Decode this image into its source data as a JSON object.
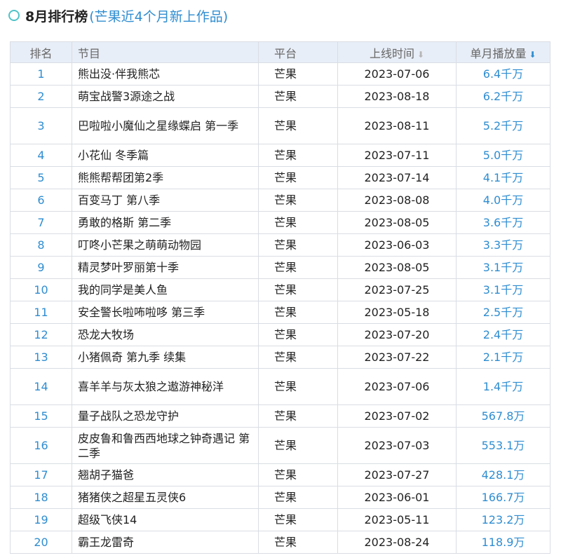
{
  "header": {
    "title": "8月排行榜",
    "subtitle": "(芒果近4个月新上作品)"
  },
  "table": {
    "columns": {
      "rank": "排名",
      "program": "节目",
      "platform": "平台",
      "date": "上线时间",
      "views": "单月播放量"
    },
    "sort_icons": {
      "date": "⬇",
      "views": "⬇"
    },
    "rows": [
      {
        "rank": "1",
        "program": "熊出没·伴我熊芯",
        "platform": "芒果",
        "date": "2023-07-06",
        "views": "6.4千万"
      },
      {
        "rank": "2",
        "program": "萌宝战警3源途之战",
        "platform": "芒果",
        "date": "2023-08-18",
        "views": "6.2千万"
      },
      {
        "rank": "3",
        "program": "巴啦啦小魔仙之星缘蝶启 第一季",
        "platform": "芒果",
        "date": "2023-08-11",
        "views": "5.2千万"
      },
      {
        "rank": "4",
        "program": "小花仙 冬季篇",
        "platform": "芒果",
        "date": "2023-07-11",
        "views": "5.0千万"
      },
      {
        "rank": "5",
        "program": "熊熊帮帮团第2季",
        "platform": "芒果",
        "date": "2023-07-14",
        "views": "4.1千万"
      },
      {
        "rank": "6",
        "program": "百变马丁 第八季",
        "platform": "芒果",
        "date": "2023-08-08",
        "views": "4.0千万"
      },
      {
        "rank": "7",
        "program": "勇敢的格斯 第二季",
        "platform": "芒果",
        "date": "2023-08-05",
        "views": "3.6千万"
      },
      {
        "rank": "8",
        "program": "叮咚小芒果之萌萌动物园",
        "platform": "芒果",
        "date": "2023-06-03",
        "views": "3.3千万"
      },
      {
        "rank": "9",
        "program": "精灵梦叶罗丽第十季",
        "platform": "芒果",
        "date": "2023-08-05",
        "views": "3.1千万"
      },
      {
        "rank": "10",
        "program": "我的同学是美人鱼",
        "platform": "芒果",
        "date": "2023-07-25",
        "views": "3.1千万"
      },
      {
        "rank": "11",
        "program": "安全警长啦咘啦哆 第三季",
        "platform": "芒果",
        "date": "2023-05-18",
        "views": "2.5千万"
      },
      {
        "rank": "12",
        "program": "恐龙大牧场",
        "platform": "芒果",
        "date": "2023-07-20",
        "views": "2.4千万"
      },
      {
        "rank": "13",
        "program": "小猪佩奇 第九季 续集",
        "platform": "芒果",
        "date": "2023-07-22",
        "views": "2.1千万"
      },
      {
        "rank": "14",
        "program": "喜羊羊与灰太狼之遨游神秘洋",
        "platform": "芒果",
        "date": "2023-07-06",
        "views": "1.4千万"
      },
      {
        "rank": "15",
        "program": "量子战队之恐龙守护",
        "platform": "芒果",
        "date": "2023-07-02",
        "views": "567.8万"
      },
      {
        "rank": "16",
        "program": "皮皮鲁和鲁西西地球之钟奇遇记 第二季",
        "platform": "芒果",
        "date": "2023-07-03",
        "views": "553.1万"
      },
      {
        "rank": "17",
        "program": "翘胡子猫爸",
        "platform": "芒果",
        "date": "2023-07-27",
        "views": "428.1万"
      },
      {
        "rank": "18",
        "program": "猪猪侠之超星五灵侠6",
        "platform": "芒果",
        "date": "2023-06-01",
        "views": "166.7万"
      },
      {
        "rank": "19",
        "program": "超级飞侠14",
        "platform": "芒果",
        "date": "2023-05-11",
        "views": "123.2万"
      },
      {
        "rank": "20",
        "program": "霸王龙雷奇",
        "platform": "芒果",
        "date": "2023-08-24",
        "views": "118.9万"
      }
    ]
  },
  "colors": {
    "accent": "#2f8dd1",
    "ring": "#4fc3c8",
    "header_bg": "#e8eef7",
    "border": "#d9dde3"
  }
}
